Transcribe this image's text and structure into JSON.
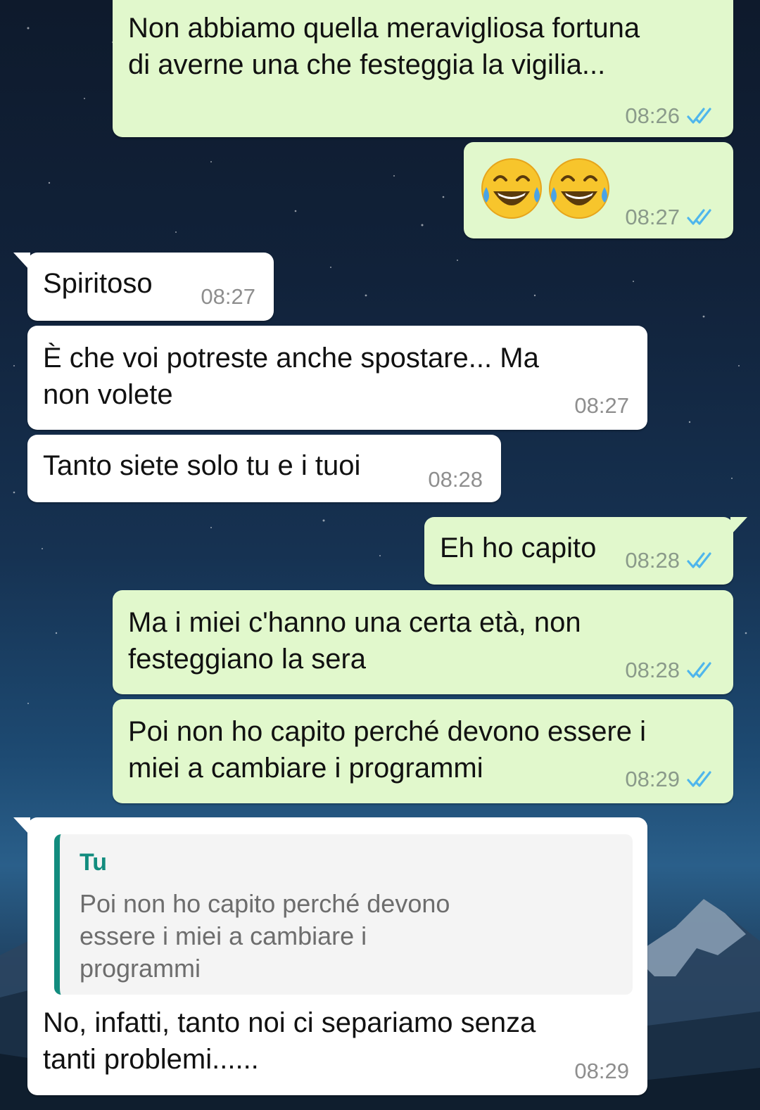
{
  "messages": [
    {
      "text": "Non abbiamo quella meravigliosa fortuna\ndi averne una che festeggia la vigilia...",
      "time": "08:26",
      "status": "read-double-check-icon"
    },
    {
      "text": "",
      "emojis": [
        "😂",
        "😂"
      ],
      "time": "08:27",
      "status": "read-double-check-icon"
    },
    {
      "text": "Spiritoso",
      "time": "08:27"
    },
    {
      "text": "È che voi potreste anche spostare... Ma\nnon volete",
      "time": "08:27"
    },
    {
      "text": "Tanto siete solo tu e i tuoi",
      "time": "08:28"
    },
    {
      "text": "Eh ho capito",
      "time": "08:28",
      "status": "read-double-check-icon"
    },
    {
      "text": "Ma i miei c'hanno una certa età, non\nfesteggiano la sera",
      "time": "08:28",
      "status": "read-double-check-icon"
    },
    {
      "text": "Poi non ho capito perché devono essere i\nmiei a cambiare i programmi",
      "time": "08:29",
      "status": "read-double-check-icon"
    },
    {
      "quote": {
        "author": "Tu",
        "text": "Poi non ho capito perché devono\nessere i miei a cambiare i\nprogrammi"
      },
      "text": "No, infatti, tanto noi ci separiamo senza\ntanti problemi......",
      "time": "08:29"
    }
  ],
  "colors": {
    "outgoing_bubble": "#e1f8cc",
    "incoming_bubble": "#ffffff",
    "read_tick": "#4fb6ec",
    "quote_accent": "#128c7e"
  }
}
